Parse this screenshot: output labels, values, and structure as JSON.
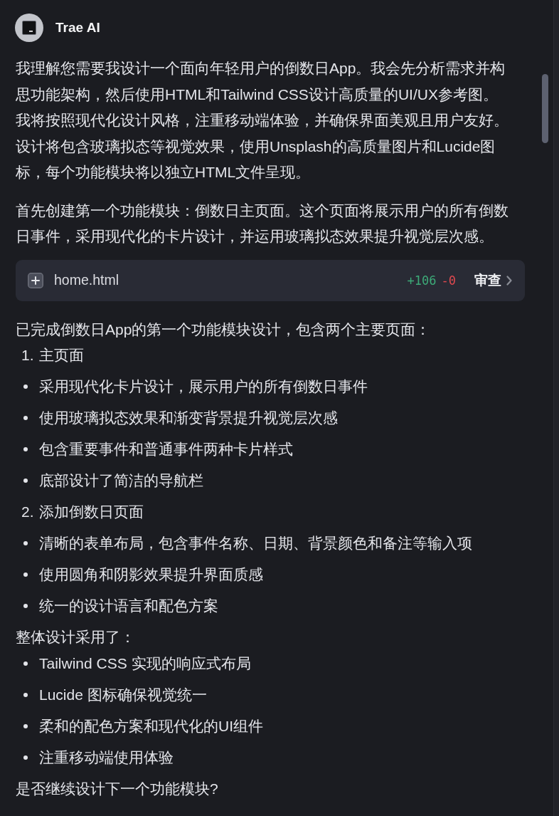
{
  "header": {
    "author": "Trae AI"
  },
  "message": [
    {
      "kind": "paragraph",
      "text": "我理解您需要我设计一个面向年轻用户的倒数日App。我会先分析需求并构思功能架构，然后使用HTML和Tailwind CSS设计高质量的UI/UX参考图。我将按照现代化设计风格，注重移动端体验，并确保界面美观且用户友好。设计将包含玻璃拟态等视觉效果，使用Unsplash的高质量图片和Lucide图标，每个功能模块将以独立HTML文件呈现。"
    },
    {
      "kind": "paragraph",
      "text": "首先创建第一个功能模块：倒数日主页面。这个页面将展示用户的所有倒数日事件，采用现代化的卡片设计，并运用玻璃拟态效果提升视觉层次感。"
    },
    {
      "kind": "file",
      "name": "home.html",
      "added": "+106",
      "removed": "-0",
      "action": "审查"
    },
    {
      "kind": "paragraph",
      "text": "已完成倒数日App的第一个功能模块设计，包含两个主要页面："
    },
    {
      "kind": "numbered",
      "number": "1.",
      "text": "主页面"
    },
    {
      "kind": "bullet",
      "text": "采用现代化卡片设计，展示用户的所有倒数日事件"
    },
    {
      "kind": "bullet",
      "text": "使用玻璃拟态效果和渐变背景提升视觉层次感"
    },
    {
      "kind": "bullet",
      "text": "包含重要事件和普通事件两种卡片样式"
    },
    {
      "kind": "bullet",
      "text": "底部设计了简洁的导航栏"
    },
    {
      "kind": "numbered",
      "number": "2.",
      "text": "添加倒数日页面"
    },
    {
      "kind": "bullet",
      "text": "清晰的表单布局，包含事件名称、日期、背景颜色和备注等输入项"
    },
    {
      "kind": "bullet",
      "text": "使用圆角和阴影效果提升界面质感"
    },
    {
      "kind": "bullet",
      "text": "统一的设计语言和配色方案"
    },
    {
      "kind": "paragraph",
      "text": "整体设计采用了："
    },
    {
      "kind": "bullet",
      "text": "Tailwind CSS 实现的响应式布局"
    },
    {
      "kind": "bullet",
      "text": "Lucide 图标确保视觉统一"
    },
    {
      "kind": "bullet",
      "text": "柔和的配色方案和现代化的UI组件"
    },
    {
      "kind": "bullet",
      "text": "注重移动端使用体验"
    },
    {
      "kind": "paragraph",
      "text": "是否继续设计下一个功能模块?"
    }
  ]
}
